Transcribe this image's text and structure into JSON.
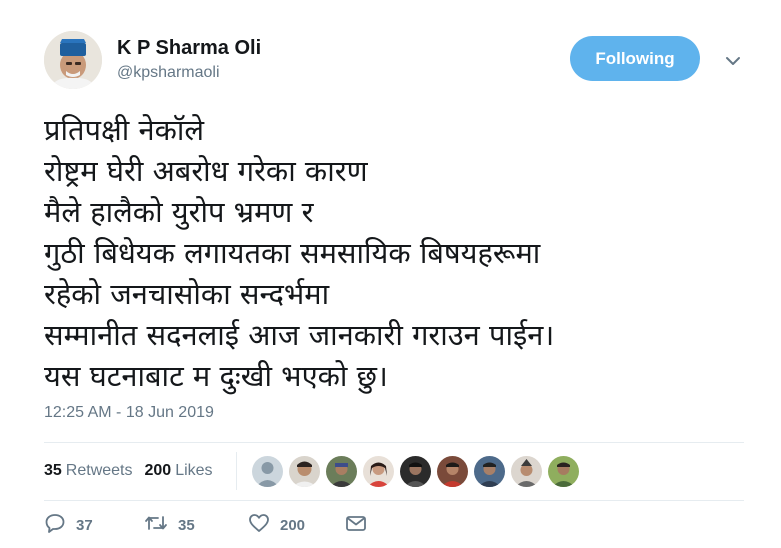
{
  "author": {
    "display_name": "K P Sharma Oli",
    "handle": "@kpsharmaoli"
  },
  "follow_button": {
    "label": "Following",
    "color": "#5fb3ed"
  },
  "tweet": {
    "lines": [
      "प्रतिपक्षी नेकॉले",
      "रोष्ट्रम घेरी अबरोध गरेका कारण",
      "मैले हालैको युरोप भ्रमण र",
      "गुठी बिधेयक लगायतका समसायिक बिषयहरूमा",
      "रहेको जनचासोका सन्दर्भमा",
      "सम्मानीत सदनलाई आज जानकारी गराउन पाईन।",
      "यस घटनाबाट म दुःखी भएको छु।"
    ],
    "timestamp": "12:25 AM - 18 Jun 2019"
  },
  "stats": {
    "retweets_count": "35",
    "retweets_label": "Retweets",
    "likes_count": "200",
    "likes_label": "Likes"
  },
  "likers": [
    "default-avatar",
    "user-avatar",
    "user-avatar",
    "user-avatar",
    "user-avatar",
    "user-avatar",
    "user-avatar",
    "user-avatar",
    "user-avatar"
  ],
  "actions": {
    "reply_count": "37",
    "retweet_count": "35",
    "like_count": "200",
    "icons": [
      "reply-icon",
      "retweet-icon",
      "like-icon",
      "direct-message-icon"
    ]
  },
  "colors": {
    "text": "#14171a",
    "secondary": "#657786",
    "accent": "#5fb3ed",
    "divider": "#e6ecf0"
  }
}
